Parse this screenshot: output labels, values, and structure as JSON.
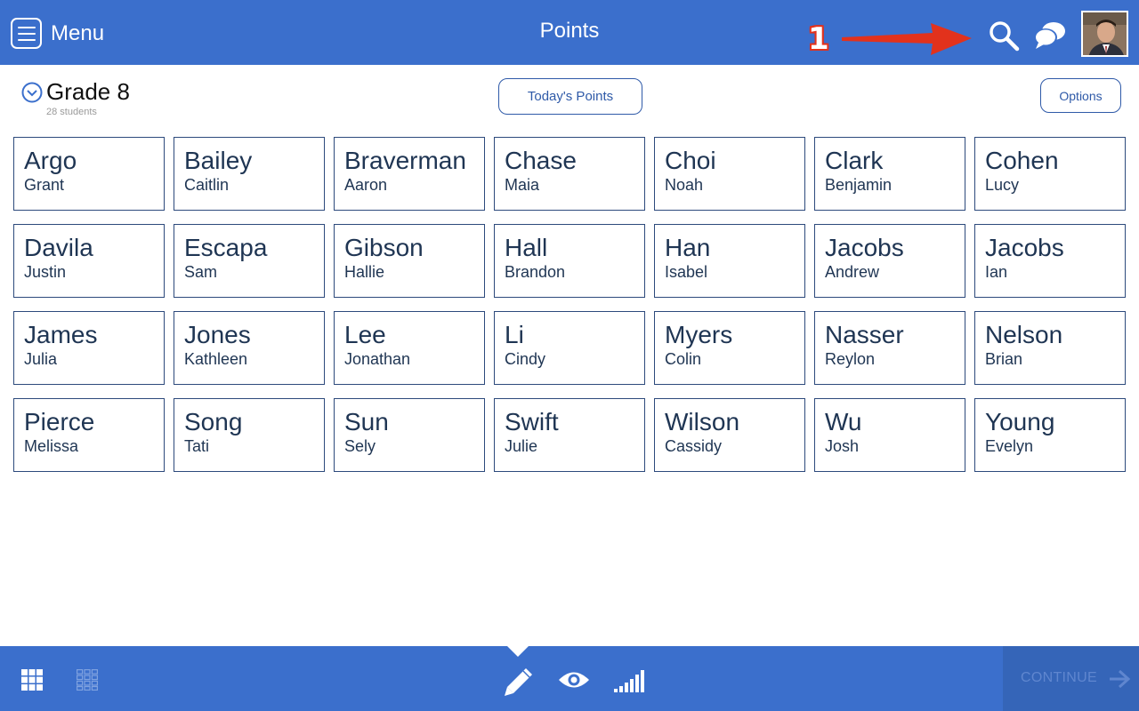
{
  "header": {
    "menu_label": "Menu",
    "title": "Points",
    "annotation_number": "1",
    "search_icon": "search-icon",
    "chat_icon": "chat-bubbles-icon",
    "avatar": "user-avatar"
  },
  "class_info": {
    "name": "Grade 8",
    "student_count": "28 students",
    "today_button": "Today's Points",
    "options_button": "Options"
  },
  "students": [
    {
      "last": "Argo",
      "first": "Grant"
    },
    {
      "last": "Bailey",
      "first": "Caitlin"
    },
    {
      "last": "Braverman",
      "first": "Aaron"
    },
    {
      "last": "Chase",
      "first": "Maia"
    },
    {
      "last": "Choi",
      "first": "Noah"
    },
    {
      "last": "Clark",
      "first": "Benjamin"
    },
    {
      "last": "Cohen",
      "first": "Lucy"
    },
    {
      "last": "Davila",
      "first": "Justin"
    },
    {
      "last": "Escapa",
      "first": "Sam"
    },
    {
      "last": "Gibson",
      "first": "Hallie"
    },
    {
      "last": "Hall",
      "first": "Brandon"
    },
    {
      "last": "Han",
      "first": "Isabel"
    },
    {
      "last": "Jacobs",
      "first": "Andrew"
    },
    {
      "last": "Jacobs",
      "first": "Ian"
    },
    {
      "last": "James",
      "first": "Julia"
    },
    {
      "last": "Jones",
      "first": "Kathleen"
    },
    {
      "last": "Lee",
      "first": "Jonathan"
    },
    {
      "last": "Li",
      "first": "Cindy"
    },
    {
      "last": "Myers",
      "first": "Colin"
    },
    {
      "last": "Nasser",
      "first": "Reylon"
    },
    {
      "last": "Nelson",
      "first": "Brian"
    },
    {
      "last": "Pierce",
      "first": "Melissa"
    },
    {
      "last": "Song",
      "first": "Tati"
    },
    {
      "last": "Sun",
      "first": "Sely"
    },
    {
      "last": "Swift",
      "first": "Julie"
    },
    {
      "last": "Wilson",
      "first": "Cassidy"
    },
    {
      "last": "Wu",
      "first": "Josh"
    },
    {
      "last": "Young",
      "first": "Evelyn"
    }
  ],
  "footer": {
    "continue_label": "CONTINUE"
  },
  "colors": {
    "bar": "#3b6fcc",
    "card_border": "#2d4a7c",
    "name_text": "#1f3553",
    "annotation": "#e2321c"
  }
}
